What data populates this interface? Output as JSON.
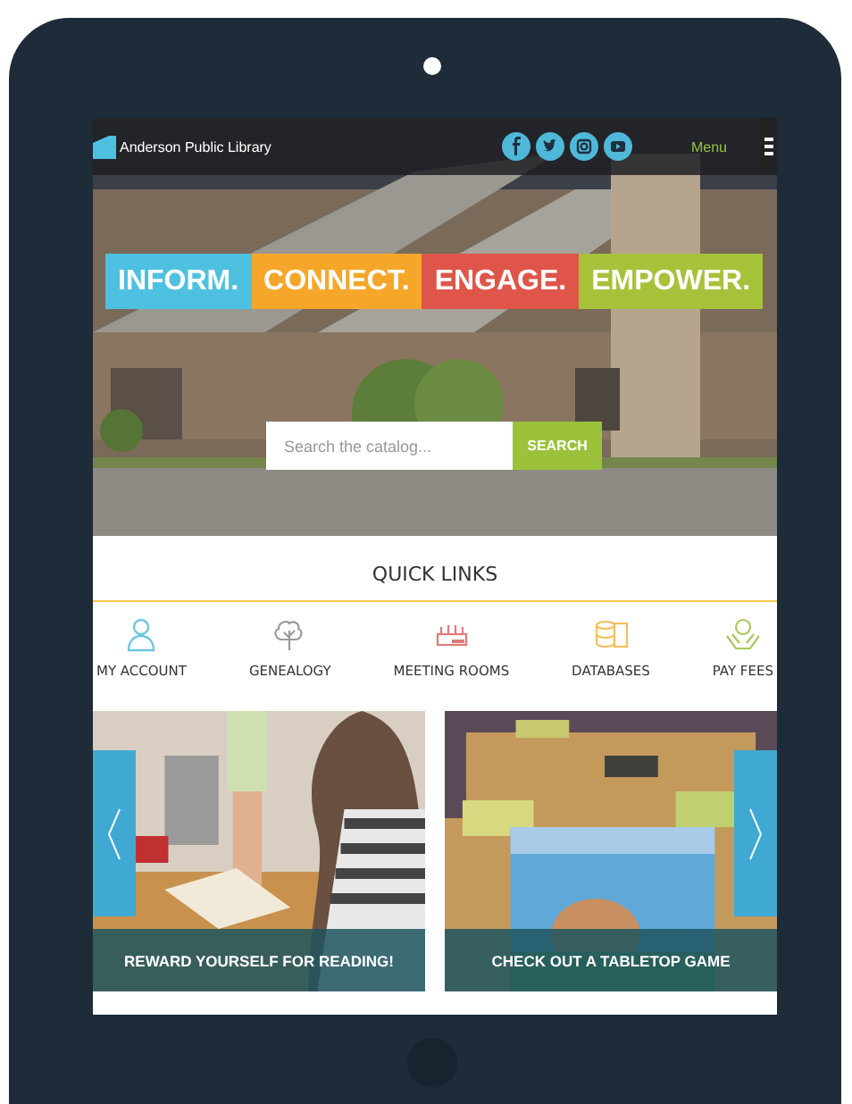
{
  "header": {
    "title": "Anderson Public Library",
    "menu_label": "Menu"
  },
  "tagline": [
    {
      "text": "INFORM.",
      "color": "#4fc1e0"
    },
    {
      "text": "CONNECT.",
      "color": "#f6a72a"
    },
    {
      "text": "ENGAGE.",
      "color": "#e0554a"
    },
    {
      "text": "EMPOWER.",
      "color": "#a6c23b"
    }
  ],
  "search": {
    "placeholder": "Search the catalog...",
    "button": "SEARCH"
  },
  "quick_links": {
    "title": "QUICK LINKS",
    "items": [
      {
        "label": "MY ACCOUNT",
        "color": "#6cc6dc"
      },
      {
        "label": "GENEALOGY",
        "color": "#999999"
      },
      {
        "label": "MEETING ROOMS",
        "color": "#e07a7a"
      },
      {
        "label": "DATABASES",
        "color": "#f0c060"
      },
      {
        "label": "PAY FEES",
        "color": "#a8c85a"
      }
    ]
  },
  "cards": [
    {
      "caption": "REWARD YOURSELF FOR READING!"
    },
    {
      "caption": "CHECK OUT A TABLETOP GAME"
    }
  ]
}
